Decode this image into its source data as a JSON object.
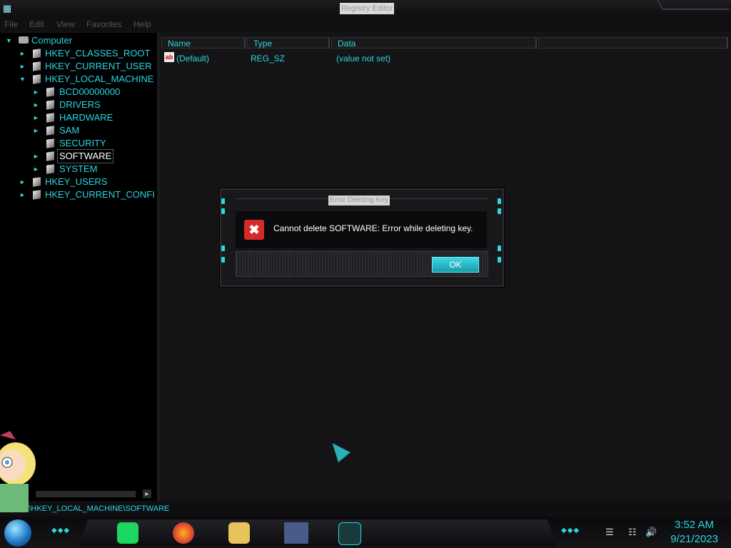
{
  "window": {
    "title": "Registry Editor"
  },
  "menu": [
    "File",
    "Edit",
    "View",
    "Favorites",
    "Help"
  ],
  "tree": {
    "root": "Computer",
    "items": [
      {
        "label": "HKEY_CLASSES_ROOT"
      },
      {
        "label": "HKEY_CURRENT_USER"
      },
      {
        "label": "HKEY_LOCAL_MACHINE"
      },
      {
        "label": "BCD00000000"
      },
      {
        "label": "DRIVERS"
      },
      {
        "label": "HARDWARE"
      },
      {
        "label": "SAM"
      },
      {
        "label": "SECURITY"
      },
      {
        "label": "SOFTWARE"
      },
      {
        "label": "SYSTEM"
      },
      {
        "label": "HKEY_USERS"
      },
      {
        "label": "HKEY_CURRENT_CONFI"
      }
    ]
  },
  "list": {
    "columns": [
      "Name",
      "Type",
      "Data"
    ],
    "rows": [
      {
        "name": "(Default)",
        "type": "REG_SZ",
        "data": "(value not set)"
      }
    ]
  },
  "status": {
    "path": "omputer\\HKEY_LOCAL_MACHINE\\SOFTWARE"
  },
  "dialog": {
    "title": "Error Deleting Key",
    "message": "Cannot delete SOFTWARE:  Error while deleting key.",
    "ok_label": "OK"
  },
  "taskbar": {
    "apps": [
      "spotify-icon",
      "firefox-icon",
      "file-explorer-icon",
      "window-icon",
      "registry-editor-icon"
    ],
    "time": "3:52 AM",
    "date": "9/21/2023"
  },
  "colors": {
    "accent": "#2ad6e0",
    "error": "#d42a2a"
  }
}
